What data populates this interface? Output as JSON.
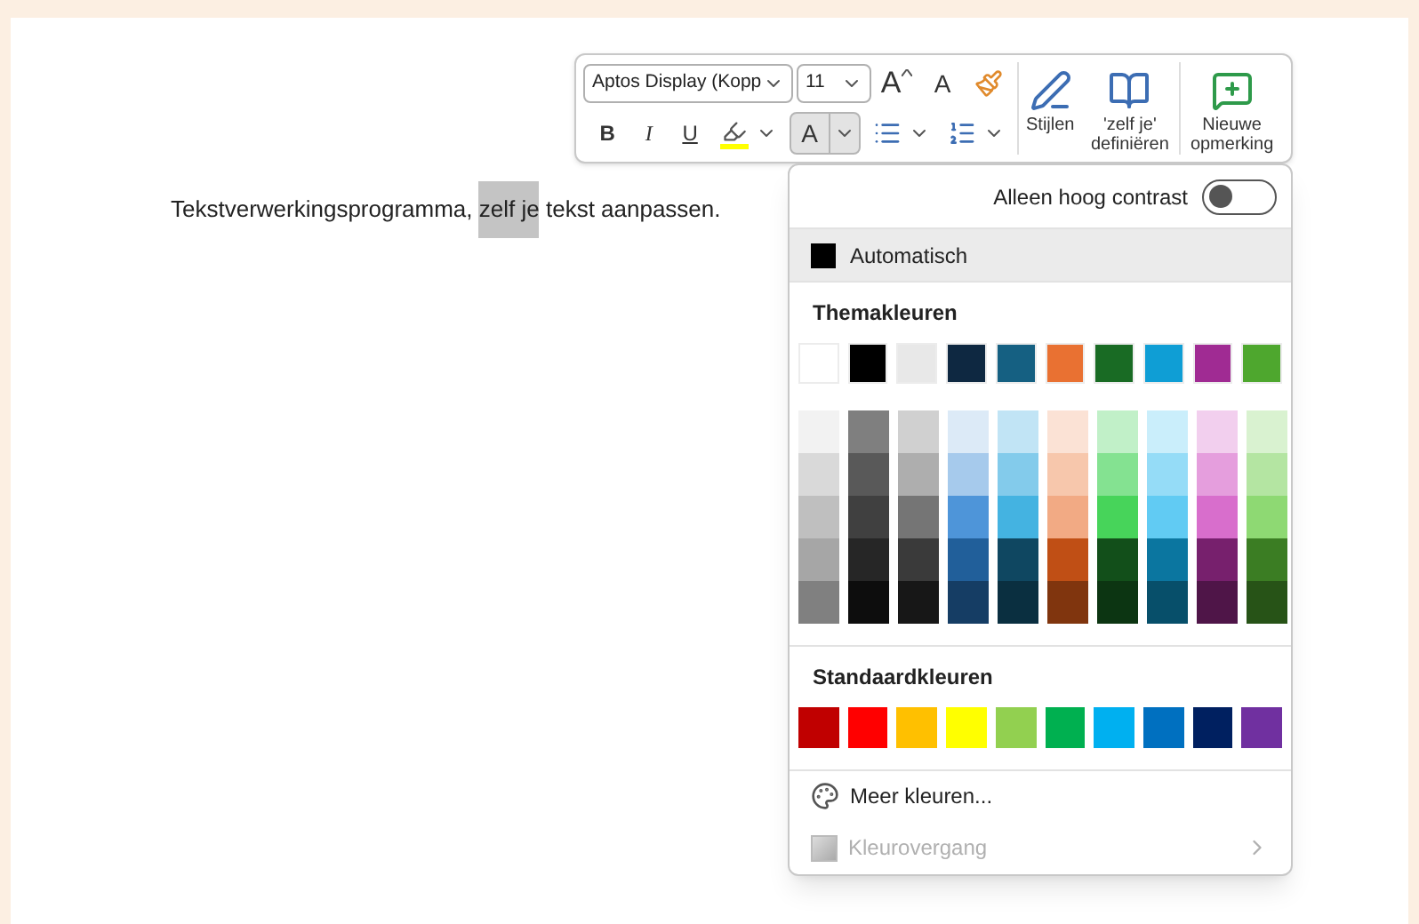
{
  "document": {
    "segments": [
      {
        "text": "Tekstverwerkingsprogramma, ",
        "selected": false
      },
      {
        "text": "zelf je",
        "selected": true
      },
      {
        "text": " tekst aanpassen.",
        "selected": false
      }
    ]
  },
  "toolbar": {
    "font_field": {
      "value": "Aptos Display (Kopp"
    },
    "size_field": {
      "value": "11"
    },
    "row1_buttons": [
      {
        "kind": "grow",
        "label": "A"
      },
      {
        "kind": "shrink",
        "label": "A"
      },
      {
        "kind": "painter"
      }
    ],
    "row2_buttons": [
      {
        "kind": "bold",
        "label": "B",
        "selected": false
      },
      {
        "kind": "italic",
        "label": "I",
        "selected": false
      },
      {
        "kind": "underline",
        "label": "U",
        "selected": false
      },
      {
        "kind": "highlight",
        "selected": false
      },
      {
        "kind": "fontcolor",
        "label": "A",
        "selected": true
      },
      {
        "kind": "bullets",
        "selected": false
      },
      {
        "kind": "numbering",
        "selected": false
      }
    ],
    "big_buttons": [
      {
        "kind": "styles",
        "label": "Stijlen"
      },
      {
        "kind": "define",
        "label": "'zelf je' definiëren"
      },
      {
        "kind": "comment",
        "label": "Nieuwe opmerking"
      }
    ]
  },
  "color_menu": {
    "contrast_toggle": {
      "label": "Alleen hoog contrast",
      "on": false
    },
    "automatic": {
      "label": "Automatisch",
      "highlighted": true,
      "color": "#000000"
    },
    "theme_title": "Themakleuren",
    "theme_colors": [
      {
        "color": "#ffffff"
      },
      {
        "color": "#000000"
      },
      {
        "color": "#e8e8e8"
      },
      {
        "color": "#0e2841"
      },
      {
        "color": "#156082"
      },
      {
        "color": "#e97132"
      },
      {
        "color": "#196b24"
      },
      {
        "color": "#0f9ed5"
      },
      {
        "color": "#a02b93"
      },
      {
        "color": "#4ea72e"
      }
    ],
    "theme_shades": [
      [
        {
          "color": "#f2f2f2"
        },
        {
          "color": "#d9d9d9"
        },
        {
          "color": "#bfbfbf"
        },
        {
          "color": "#a6a6a6"
        },
        {
          "color": "#808080"
        }
      ],
      [
        {
          "color": "#7f7f7f"
        },
        {
          "color": "#595959"
        },
        {
          "color": "#404040"
        },
        {
          "color": "#262626"
        },
        {
          "color": "#0d0d0d"
        }
      ],
      [
        {
          "color": "#d0d0d0"
        },
        {
          "color": "#aeaeae"
        },
        {
          "color": "#757575"
        },
        {
          "color": "#3a3a3a"
        },
        {
          "color": "#171717"
        }
      ],
      [
        {
          "color": "#dceaf7"
        },
        {
          "color": "#a6caec"
        },
        {
          "color": "#4e95d9"
        },
        {
          "color": "#215f9a"
        },
        {
          "color": "#153d64"
        }
      ],
      [
        {
          "color": "#c1e4f5"
        },
        {
          "color": "#83cbeb"
        },
        {
          "color": "#44b3e1"
        },
        {
          "color": "#0f4761"
        },
        {
          "color": "#0a2f40"
        }
      ],
      [
        {
          "color": "#fbe2d5"
        },
        {
          "color": "#f7c7ac"
        },
        {
          "color": "#f2aa84"
        },
        {
          "color": "#c04f15"
        },
        {
          "color": "#80350e"
        }
      ],
      [
        {
          "color": "#c1f0c8"
        },
        {
          "color": "#84e291"
        },
        {
          "color": "#47d45a"
        },
        {
          "color": "#124f1a"
        },
        {
          "color": "#0c3512"
        }
      ],
      [
        {
          "color": "#caeefb"
        },
        {
          "color": "#95dcf7"
        },
        {
          "color": "#61cbf3"
        },
        {
          "color": "#0b76a0"
        },
        {
          "color": "#074f6a"
        }
      ],
      [
        {
          "color": "#f2cfee"
        },
        {
          "color": "#e59edd"
        },
        {
          "color": "#d86ecc"
        },
        {
          "color": "#77206d"
        },
        {
          "color": "#4f1548"
        }
      ],
      [
        {
          "color": "#d9f2d0"
        },
        {
          "color": "#b4e5a2"
        },
        {
          "color": "#8ed973"
        },
        {
          "color": "#3b7d23"
        },
        {
          "color": "#275317"
        }
      ]
    ],
    "standard_title": "Standaardkleuren",
    "standard_colors": [
      {
        "color": "#c00000"
      },
      {
        "color": "#ff0000"
      },
      {
        "color": "#ffc000"
      },
      {
        "color": "#ffff00"
      },
      {
        "color": "#92d050"
      },
      {
        "color": "#00b050"
      },
      {
        "color": "#00b0f0"
      },
      {
        "color": "#0070c0"
      },
      {
        "color": "#002060"
      },
      {
        "color": "#7030a0"
      }
    ],
    "more_colors": {
      "label": "Meer kleuren..."
    },
    "gradient": {
      "label": "Kleurovergang",
      "disabled": true
    }
  }
}
